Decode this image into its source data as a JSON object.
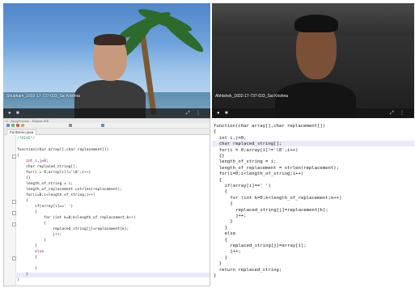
{
  "video_tiles": [
    {
      "name_label": "Shubham_1602-17-737-033_Sai Krishna"
    },
    {
      "name_label": "Abhishek_1602-17-737-033_Sai Krishna"
    }
  ],
  "editor": {
    "window_title": "C - ArrayFun/src - Eclipse IDE",
    "tab_label": "FunDemo.java",
    "lines": [
      {
        "text": "/*DIVE*/",
        "style": "comment",
        "fold": false
      },
      {
        "text": "",
        "style": "",
        "fold": false
      },
      {
        "text": "function(char array[],char replacement[])",
        "style": "",
        "fold": false
      },
      {
        "text": "{",
        "style": "",
        "fold": true
      },
      {
        "text": "    int i,j=0;",
        "style": "kw",
        "fold": false
      },
      {
        "text": "    char replaced_string[];",
        "style": "",
        "fold": false
      },
      {
        "text": "    for(i = 0;array[i]!='\\0';i++)",
        "style": "",
        "fold": false
      },
      {
        "text": "    {}",
        "style": "",
        "fold": false
      },
      {
        "text": "    length_of_string = i;",
        "style": "",
        "fold": false
      },
      {
        "text": "    length_of_replacement =strlen(replacement);",
        "style": "",
        "fold": false
      },
      {
        "text": "    for(i=0;i<length_of_string;i++)",
        "style": "",
        "fold": false
      },
      {
        "text": "    {",
        "style": "",
        "fold": true
      },
      {
        "text": "        if(array[i]==' ')",
        "style": "",
        "fold": false
      },
      {
        "text": "        {",
        "style": "",
        "fold": true
      },
      {
        "text": "            for (int k=0;k<length_of_replacement;k++)",
        "style": "",
        "fold": false
      },
      {
        "text": "            {",
        "style": "",
        "fold": true
      },
      {
        "text": "                replaced_string[j]=replacement[k];",
        "style": "",
        "fold": false
      },
      {
        "text": "                j++;",
        "style": "",
        "fold": false
      },
      {
        "text": "            }",
        "style": "",
        "fold": false
      },
      {
        "text": "        }",
        "style": "",
        "fold": false
      },
      {
        "text": "        else",
        "style": "kw",
        "fold": false
      },
      {
        "text": "        {",
        "style": "",
        "fold": true
      },
      {
        "text": "",
        "style": "",
        "fold": false
      },
      {
        "text": "        }",
        "style": "",
        "fold": false
      },
      {
        "text": "    }",
        "style": "",
        "fold": false
      },
      {
        "text": "}",
        "style": "",
        "fold": false
      }
    ],
    "highlight_line": 24
  },
  "panel": {
    "lines": [
      {
        "text": "function(char array[],char replacement[])",
        "indent": 0
      },
      {
        "text": "{",
        "indent": 0
      },
      {
        "text": "int i,j=0;",
        "indent": 2
      },
      {
        "text": "char replaced_string[];",
        "indent": 2
      },
      {
        "text": "for(i = 0;array[i]!='\\0';i++)",
        "indent": 2
      },
      {
        "text": "{}",
        "indent": 2
      },
      {
        "text": "length_of_string = i;",
        "indent": 2
      },
      {
        "text": "length_of_replacement = strlen(replacement);",
        "indent": 2
      },
      {
        "text": "for(i=0;i<length_of_string;i++)",
        "indent": 2
      },
      {
        "text": "{",
        "indent": 2
      },
      {
        "text": "if(array[i]==' ')",
        "indent": 4
      },
      {
        "text": "{",
        "indent": 4
      },
      {
        "text": "for (int k=0;k<length_of_replacement;k++)",
        "indent": 6
      },
      {
        "text": "{",
        "indent": 6
      },
      {
        "text": "replaced_string[j]=replacement[k];",
        "indent": 8
      },
      {
        "text": "j++;",
        "indent": 8
      },
      {
        "text": "}",
        "indent": 6
      },
      {
        "text": "}",
        "indent": 4
      },
      {
        "text": "else",
        "indent": 4
      },
      {
        "text": "{",
        "indent": 4
      },
      {
        "text": "replaced_string[j]=array[i];",
        "indent": 6
      },
      {
        "text": "j++;",
        "indent": 6
      },
      {
        "text": "}",
        "indent": 4
      },
      {
        "text": "}",
        "indent": 2
      },
      {
        "text": "return replaced_string;",
        "indent": 2
      },
      {
        "text": "}",
        "indent": 0
      }
    ],
    "highlight_line": 3
  }
}
